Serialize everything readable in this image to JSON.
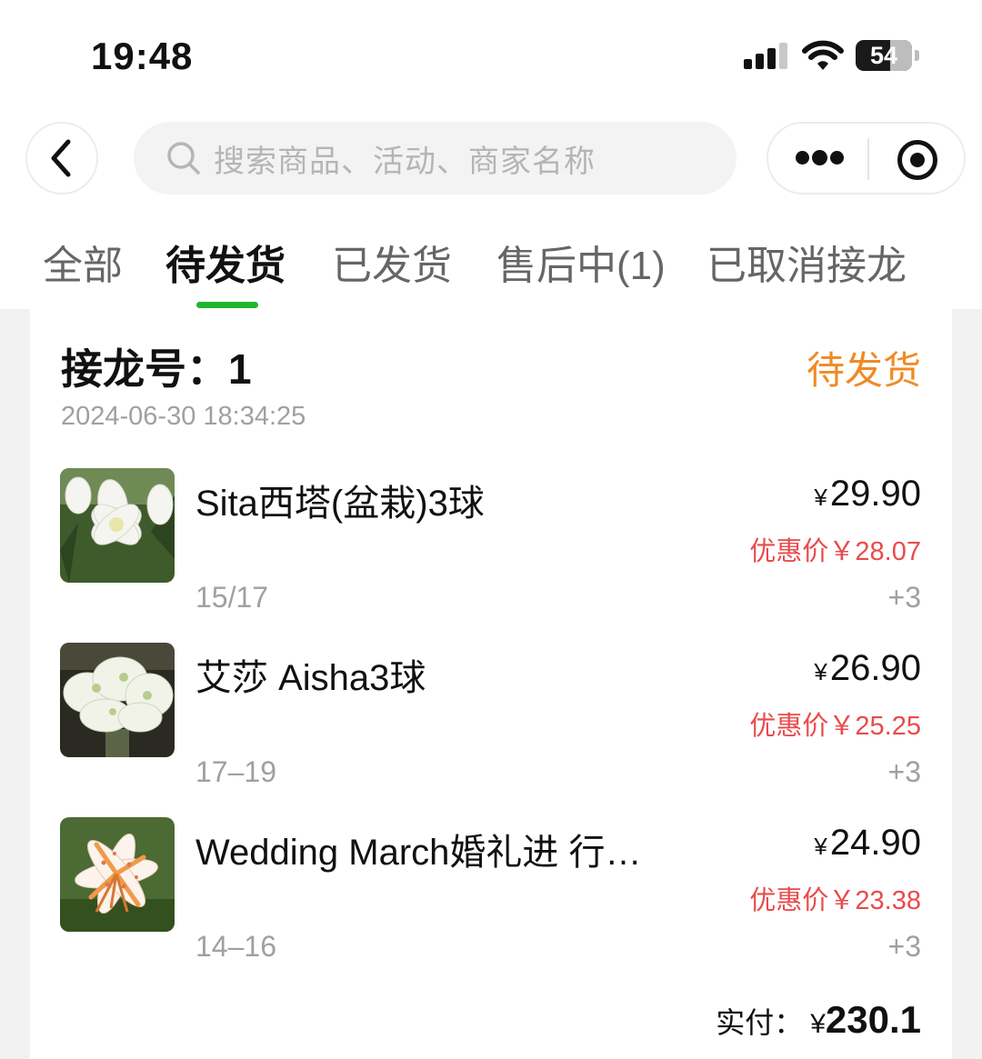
{
  "status_bar": {
    "time": "19:48",
    "battery": "54"
  },
  "search": {
    "placeholder": "搜索商品、活动、商家名称"
  },
  "tabs": [
    {
      "label": "全部"
    },
    {
      "label": "待发货"
    },
    {
      "label": "已发货"
    },
    {
      "label": "售后中(1)"
    },
    {
      "label": "已取消接龙"
    }
  ],
  "active_tab": "待发货",
  "order": {
    "number_label": "接龙号：1",
    "status": "待发货",
    "time": "2024-06-30 18:34:25",
    "items": [
      {
        "name": "Sita西塔(盆栽)3球",
        "spec": "15/17",
        "price": "29.90",
        "discount_label": "优惠价￥28.07",
        "quantity": "+3",
        "image": "white-lily-photo"
      },
      {
        "name": "艾莎 Aisha3球",
        "spec": "17–19",
        "price": "26.90",
        "discount_label": "优惠价￥25.25",
        "quantity": "+3",
        "image": "white-double-lily-photo"
      },
      {
        "name": "Wedding March婚礼进 行…",
        "spec": "14–16",
        "price": "24.90",
        "discount_label": "优惠价￥23.38",
        "quantity": "+3",
        "image": "spotted-orange-lily-photo"
      }
    ],
    "currency_symbol": "¥",
    "total_label": "实付：",
    "total_amount": "230.1"
  },
  "colors": {
    "accent_green": "#1fb52f",
    "status_orange": "#f08a24",
    "discount_red": "#e94b4b"
  },
  "icons": [
    "back-chevron-icon",
    "search-icon",
    "more-dots-icon",
    "target-icon",
    "signal-icon",
    "wifi-icon",
    "battery-icon"
  ]
}
